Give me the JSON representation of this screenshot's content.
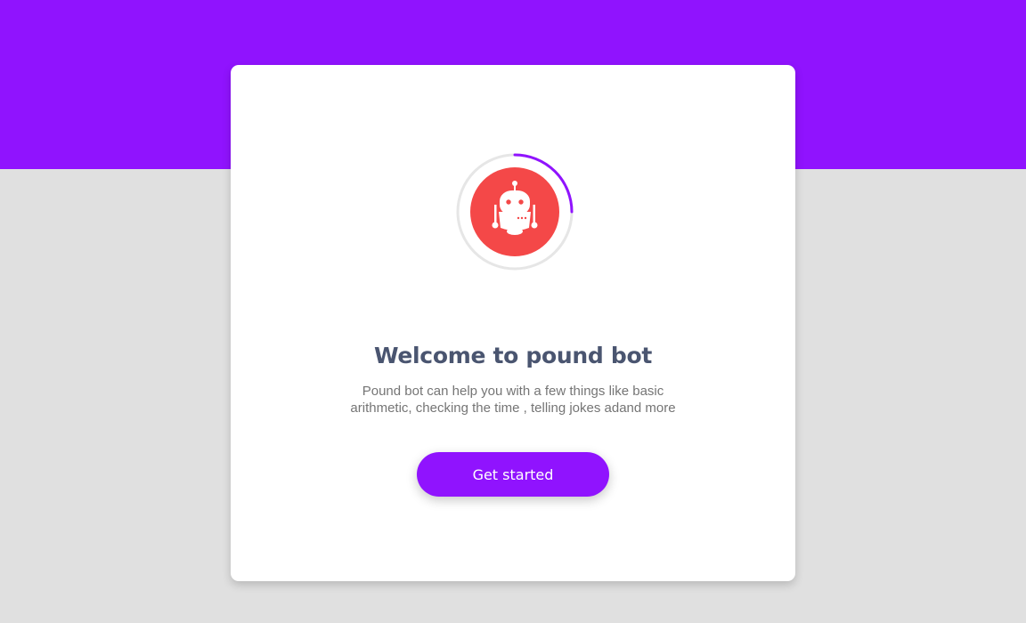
{
  "colors": {
    "brand": "#9013fe",
    "background": "#e0e0e0",
    "card": "#ffffff",
    "avatar": "#f44848",
    "title": "#4a5570",
    "description": "#757575"
  },
  "avatar": {
    "icon": "robot-icon",
    "progress_fraction": 0.25
  },
  "welcome": {
    "title": "Welcome to pound bot",
    "description": "Pound bot can help you with a few things like basic arithmetic, checking the time , telling jokes adand more"
  },
  "actions": {
    "get_started_label": "Get started"
  }
}
